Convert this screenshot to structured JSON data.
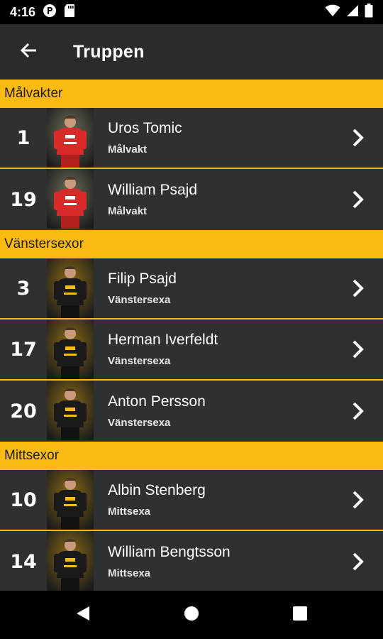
{
  "status_bar": {
    "time": "4:16",
    "icons": [
      "app-p-icon",
      "sd-card-icon",
      "wifi-icon",
      "signal-icon",
      "battery-icon"
    ]
  },
  "app_bar": {
    "title": "Truppen",
    "back_icon": "arrow-left-icon"
  },
  "sections": [
    {
      "title": "Målvakter",
      "players": [
        {
          "number": "1",
          "name": "Uros Tomic",
          "position": "Målvakt",
          "kit": "red"
        },
        {
          "number": "19",
          "name": "William Psajd",
          "position": "Målvakt",
          "kit": "red"
        }
      ]
    },
    {
      "title": "Vänstersexor",
      "players": [
        {
          "number": "3",
          "name": "Filip Psajd",
          "position": "Vänstersexa",
          "kit": "black"
        },
        {
          "number": "17",
          "name": "Herman Iverfeldt",
          "position": "Vänstersexa",
          "kit": "black"
        },
        {
          "number": "20",
          "name": "Anton Persson",
          "position": "Vänstersexa",
          "kit": "black"
        }
      ]
    },
    {
      "title": "Mittsexor",
      "players": [
        {
          "number": "10",
          "name": "Albin Stenberg",
          "position": "Mittsexa",
          "kit": "black"
        },
        {
          "number": "14",
          "name": "William Bengtsson",
          "position": "Mittsexa",
          "kit": "black"
        }
      ]
    }
  ],
  "colors": {
    "accent": "#fcbb12",
    "app_bar": "#2a2b2e",
    "row": "#2f3034",
    "goalkeeper_kit": "#d92a2a",
    "field_kit": "#1a1a1a"
  },
  "nav_bar": {
    "buttons": [
      "back-triangle-icon",
      "home-circle-icon",
      "recents-square-icon"
    ]
  }
}
